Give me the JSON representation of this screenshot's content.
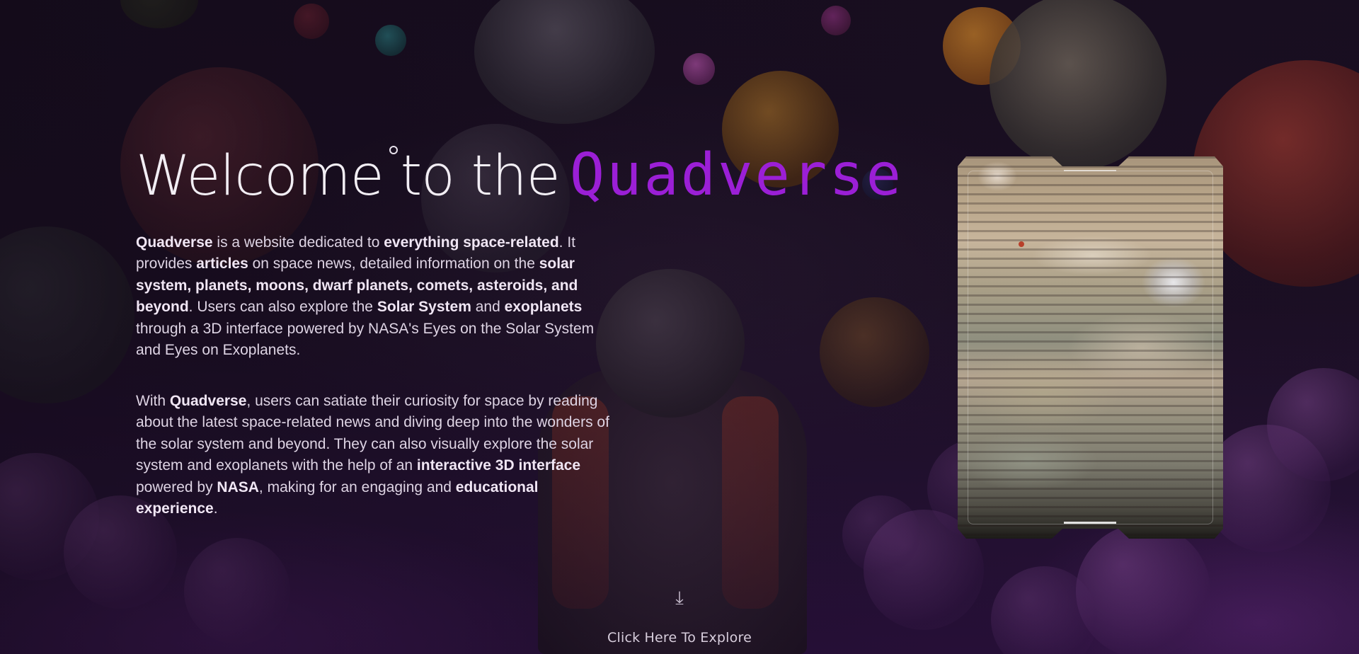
{
  "hero": {
    "title_prefix": "Welcome to the",
    "title_brand": "Quadverse"
  },
  "intro": {
    "p1": [
      {
        "text": "Quadverse",
        "bold": true
      },
      {
        "text": " is a website dedicated to ",
        "bold": false
      },
      {
        "text": "everything space-related",
        "bold": true
      },
      {
        "text": ". It provides ",
        "bold": false
      },
      {
        "text": "articles",
        "bold": true
      },
      {
        "text": " on space news, detailed information on the ",
        "bold": false
      },
      {
        "text": "solar system, planets, moons, dwarf planets, comets, asteroids, and beyond",
        "bold": true
      },
      {
        "text": ". Users can also explore the ",
        "bold": false
      },
      {
        "text": "Solar System",
        "bold": true
      },
      {
        "text": " and ",
        "bold": false
      },
      {
        "text": "exoplanets",
        "bold": true
      },
      {
        "text": " through a 3D interface powered by NASA's Eyes on the Solar System and Eyes on Exoplanets.",
        "bold": false
      }
    ],
    "p2": [
      {
        "text": "With ",
        "bold": false
      },
      {
        "text": "Quadverse",
        "bold": true
      },
      {
        "text": ", users can satiate their curiosity for space by reading about the latest space-related news and diving deep into the wonders of the solar system and beyond. They can also visually explore the solar system and exoplanets with the help of an ",
        "bold": false
      },
      {
        "text": "interactive 3D interface",
        "bold": true
      },
      {
        "text": " powered by ",
        "bold": false
      },
      {
        "text": "NASA",
        "bold": true
      },
      {
        "text": ", making for an engaging and ",
        "bold": false
      },
      {
        "text": "educational experience",
        "bold": true
      },
      {
        "text": ".",
        "bold": false
      }
    ]
  },
  "card": {
    "image": "jupiter-planet-image"
  },
  "explore": {
    "icon": "arrow-down-icon",
    "label": "Click Here To Explore"
  },
  "colors": {
    "brand": "#9b1fd6",
    "background": "#1d1026",
    "text": "#ded4e4"
  }
}
